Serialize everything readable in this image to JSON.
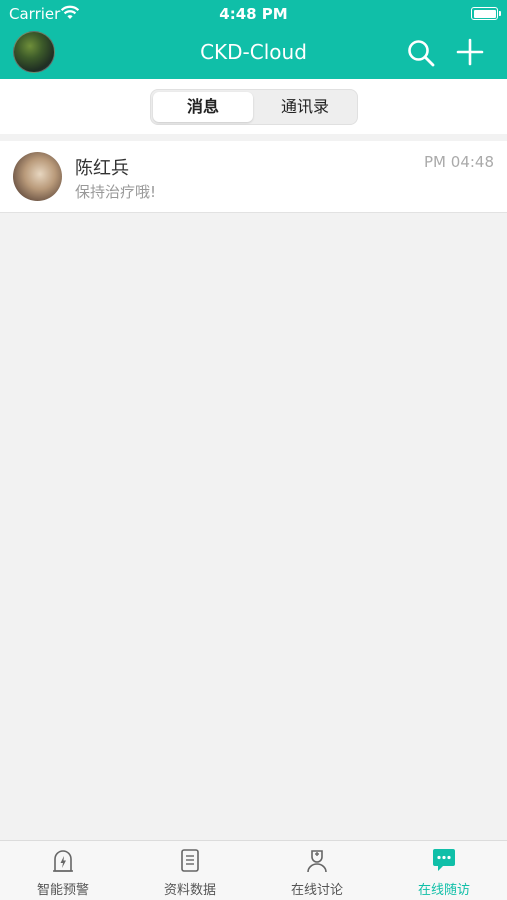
{
  "status_bar": {
    "carrier": "Carrier",
    "time": "4:48 PM"
  },
  "header": {
    "title": "CKD-Cloud",
    "search_icon": "search-icon",
    "add_icon": "plus-icon"
  },
  "segments": [
    {
      "label": "消息",
      "selected": true
    },
    {
      "label": "通讯录",
      "selected": false
    }
  ],
  "conversations": [
    {
      "name": "陈红兵",
      "message": "保持治疗哦!",
      "time": "PM 04:48"
    }
  ],
  "tabs": [
    {
      "label": "智能预警",
      "icon": "alert-icon",
      "active": false
    },
    {
      "label": "资料数据",
      "icon": "document-icon",
      "active": false
    },
    {
      "label": "在线讨论",
      "icon": "doctor-icon",
      "active": false
    },
    {
      "label": "在线随访",
      "icon": "chat-bubble-icon",
      "active": true
    }
  ],
  "colors": {
    "accent": "#10bfa8",
    "background": "#f2f2f2",
    "tab_inactive": "#555555"
  }
}
